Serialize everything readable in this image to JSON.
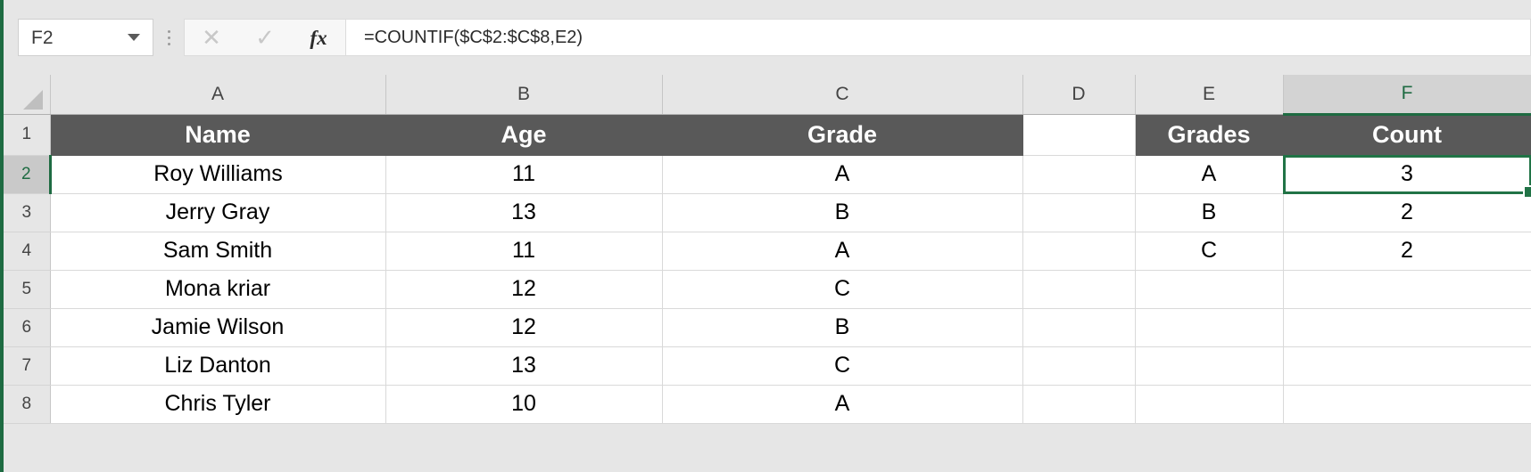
{
  "formula_bar": {
    "name_box_value": "F2",
    "name_box_placeholder": "Name Box",
    "cancel_icon": "close-icon",
    "enter_icon": "check-icon",
    "function_icon": "fx-icon",
    "function_label": "fx",
    "cancel_glyph": "✕",
    "enter_glyph": "✓",
    "formula_value": "=COUNTIF($C$2:$C$8,E2)",
    "formula_placeholder": "Enter formula"
  },
  "grid": {
    "column_headers": [
      "A",
      "B",
      "C",
      "D",
      "E",
      "F"
    ],
    "active_column": "F",
    "row_headers": [
      "1",
      "2",
      "3",
      "4",
      "5",
      "6",
      "7",
      "8"
    ],
    "active_row": "2",
    "active_cell": "F2",
    "selection_color": "#217346",
    "header_fill_color": "#595959",
    "header_text_color": "#ffffff",
    "rows": [
      {
        "row": "1",
        "cells": [
          {
            "ref": "A1",
            "value": "Name",
            "style": "header"
          },
          {
            "ref": "B1",
            "value": "Age",
            "style": "header"
          },
          {
            "ref": "C1",
            "value": "Grade",
            "style": "header"
          },
          {
            "ref": "D1",
            "value": "",
            "style": "plain"
          },
          {
            "ref": "E1",
            "value": "Grades",
            "style": "header"
          },
          {
            "ref": "F1",
            "value": "Count",
            "style": "header"
          }
        ]
      },
      {
        "row": "2",
        "cells": [
          {
            "ref": "A2",
            "value": "Roy Williams",
            "style": "data"
          },
          {
            "ref": "B2",
            "value": "11",
            "style": "data"
          },
          {
            "ref": "C2",
            "value": "A",
            "style": "data"
          },
          {
            "ref": "D2",
            "value": "",
            "style": "data"
          },
          {
            "ref": "E2",
            "value": "A",
            "style": "data"
          },
          {
            "ref": "F2",
            "value": "3",
            "style": "selected"
          }
        ]
      },
      {
        "row": "3",
        "cells": [
          {
            "ref": "A3",
            "value": "Jerry Gray",
            "style": "data"
          },
          {
            "ref": "B3",
            "value": "13",
            "style": "data"
          },
          {
            "ref": "C3",
            "value": "B",
            "style": "data"
          },
          {
            "ref": "D3",
            "value": "",
            "style": "data"
          },
          {
            "ref": "E3",
            "value": "B",
            "style": "data"
          },
          {
            "ref": "F3",
            "value": "2",
            "style": "data"
          }
        ]
      },
      {
        "row": "4",
        "cells": [
          {
            "ref": "A4",
            "value": "Sam Smith",
            "style": "data"
          },
          {
            "ref": "B4",
            "value": "11",
            "style": "data"
          },
          {
            "ref": "C4",
            "value": "A",
            "style": "data"
          },
          {
            "ref": "D4",
            "value": "",
            "style": "data"
          },
          {
            "ref": "E4",
            "value": "C",
            "style": "data"
          },
          {
            "ref": "F4",
            "value": "2",
            "style": "data"
          }
        ]
      },
      {
        "row": "5",
        "cells": [
          {
            "ref": "A5",
            "value": "Mona kriar",
            "style": "data"
          },
          {
            "ref": "B5",
            "value": "12",
            "style": "data"
          },
          {
            "ref": "C5",
            "value": "C",
            "style": "data"
          },
          {
            "ref": "D5",
            "value": "",
            "style": "data"
          },
          {
            "ref": "E5",
            "value": "",
            "style": "data"
          },
          {
            "ref": "F5",
            "value": "",
            "style": "data"
          }
        ]
      },
      {
        "row": "6",
        "cells": [
          {
            "ref": "A6",
            "value": "Jamie Wilson",
            "style": "data"
          },
          {
            "ref": "B6",
            "value": "12",
            "style": "data"
          },
          {
            "ref": "C6",
            "value": "B",
            "style": "data"
          },
          {
            "ref": "D6",
            "value": "",
            "style": "data"
          },
          {
            "ref": "E6",
            "value": "",
            "style": "data"
          },
          {
            "ref": "F6",
            "value": "",
            "style": "data"
          }
        ]
      },
      {
        "row": "7",
        "cells": [
          {
            "ref": "A7",
            "value": "Liz Danton",
            "style": "data"
          },
          {
            "ref": "B7",
            "value": "13",
            "style": "data"
          },
          {
            "ref": "C7",
            "value": "C",
            "style": "data"
          },
          {
            "ref": "D7",
            "value": "",
            "style": "data"
          },
          {
            "ref": "E7",
            "value": "",
            "style": "data"
          },
          {
            "ref": "F7",
            "value": "",
            "style": "data"
          }
        ]
      },
      {
        "row": "8",
        "cells": [
          {
            "ref": "A8",
            "value": "Chris Tyler",
            "style": "data"
          },
          {
            "ref": "B8",
            "value": "10",
            "style": "data"
          },
          {
            "ref": "C8",
            "value": "A",
            "style": "data"
          },
          {
            "ref": "D8",
            "value": "",
            "style": "data"
          },
          {
            "ref": "E8",
            "value": "",
            "style": "data"
          },
          {
            "ref": "F8",
            "value": "",
            "style": "data"
          }
        ]
      }
    ]
  }
}
